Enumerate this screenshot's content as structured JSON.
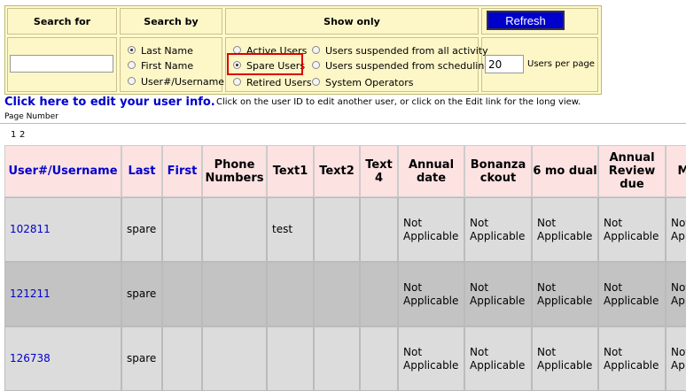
{
  "search_panel": {
    "headers": {
      "search_for": "Search for",
      "search_by": "Search by",
      "show_only": "Show only"
    },
    "refresh_label": "Refresh",
    "search_value": "",
    "search_by_options": [
      {
        "label": "Last Name",
        "selected": true
      },
      {
        "label": "First Name",
        "selected": false
      },
      {
        "label": "User#/Username",
        "selected": false
      }
    ],
    "show_only_left": [
      {
        "label": "Active Users",
        "selected": false
      },
      {
        "label": "Spare Users",
        "selected": true
      },
      {
        "label": "Retired Users",
        "selected": false
      }
    ],
    "show_only_right": [
      {
        "label": "Users suspended from all activity",
        "selected": false
      },
      {
        "label": "Users suspended from scheduling",
        "selected": false
      },
      {
        "label": "System Operators",
        "selected": false
      }
    ],
    "users_per_page": "20",
    "users_per_page_label": "Users per page",
    "highlight_color": "#dd0000"
  },
  "edit_info": {
    "link_text": "Click here to edit your user info.",
    "note": "Click on the user ID to edit another user, or click on the Edit link for the long view."
  },
  "pagination": {
    "label": "Page Number",
    "pages": [
      "1",
      "2"
    ]
  },
  "table": {
    "columns": [
      "User#/Username",
      "Last",
      "First",
      "Phone Numbers",
      "Text1",
      "Text2",
      "Text 4",
      "Annual date",
      "Bonanza ckout",
      "6 mo dual",
      "Annual Review due",
      "M"
    ],
    "rows": [
      [
        "102811",
        "spare",
        "",
        "",
        "test",
        "",
        "",
        "Not Applicable",
        "Not Applicable",
        "Not Applicable",
        "Not Applicable",
        "Not Applicable"
      ],
      [
        "121211",
        "spare",
        "",
        "",
        "",
        "",
        "",
        "Not Applicable",
        "Not Applicable",
        "Not Applicable",
        "Not Applicable",
        "Not Applicable"
      ],
      [
        "126738",
        "spare",
        "",
        "",
        "",
        "",
        "",
        "Not Applicable",
        "Not Applicable",
        "Not Applicable",
        "Not Applicable",
        "Not Applicable"
      ]
    ],
    "header_bg": "#fde2e2",
    "link_color": "#0000cc"
  }
}
